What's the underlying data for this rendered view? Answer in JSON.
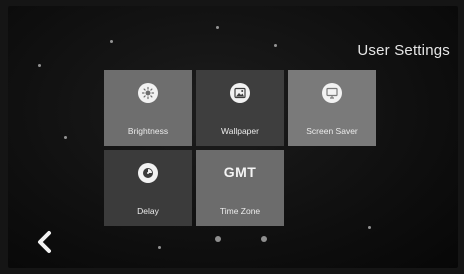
{
  "header": {
    "title": "User Settings"
  },
  "tiles": [
    {
      "label": "Brightness",
      "icon": "brightness-icon"
    },
    {
      "label": "Wallpaper",
      "icon": "image-icon"
    },
    {
      "label": "Screen Saver",
      "icon": "monitor-icon"
    },
    {
      "label": "Delay",
      "icon": "timer-icon"
    },
    {
      "label": "Time Zone",
      "icon": "gmt-text",
      "icon_text": "GMT"
    }
  ],
  "navigation": {
    "back_icon": "chevron-left-icon"
  },
  "pagination": {
    "pages": 2,
    "current": 1
  }
}
